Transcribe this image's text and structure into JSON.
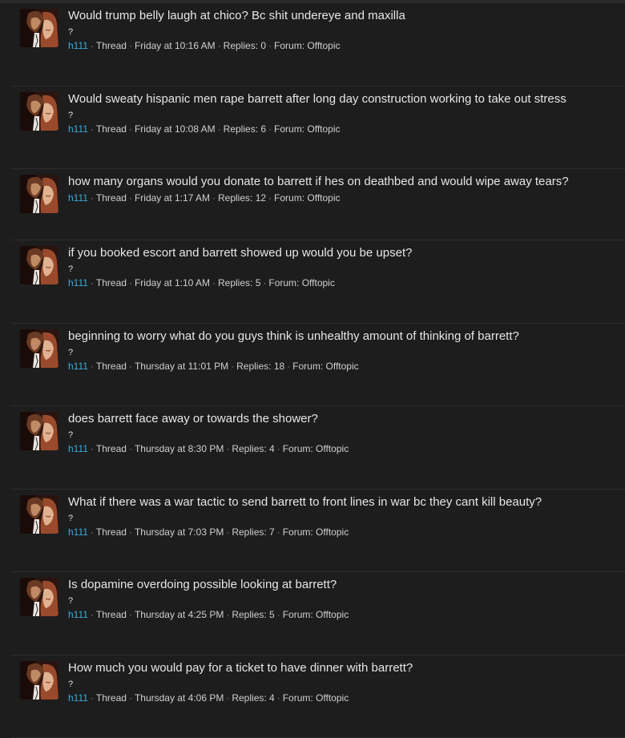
{
  "threads": [
    {
      "title": "Would trump belly laugh at chico? Bc shit undereye and maxilla",
      "snippet": "?",
      "user": "h111",
      "type": "Thread",
      "time": "Friday at 10:16 AM",
      "replies": "Replies: 0",
      "forum": "Forum: Offtopic"
    },
    {
      "title": "Would sweaty hispanic men rape barrett after long day construction working to take out stress",
      "snippet": "?",
      "user": "h111",
      "type": "Thread",
      "time": "Friday at 10:08 AM",
      "replies": "Replies: 6",
      "forum": "Forum: Offtopic"
    },
    {
      "title": "how many organs would you donate to barrett if hes on deathbed and would wipe away tears?",
      "snippet": "",
      "user": "h111",
      "type": "Thread",
      "time": "Friday at 1:17 AM",
      "replies": "Replies: 12",
      "forum": "Forum: Offtopic"
    },
    {
      "title": "if you booked escort and barrett showed up would you be upset?",
      "snippet": "?",
      "user": "h111",
      "type": "Thread",
      "time": "Friday at 1:10 AM",
      "replies": "Replies: 5",
      "forum": "Forum: Offtopic"
    },
    {
      "title": "beginning to worry what do you guys think is unhealthy amount of thinking of barrett?",
      "snippet": "?",
      "user": "h111",
      "type": "Thread",
      "time": "Thursday at 11:01 PM",
      "replies": "Replies: 18",
      "forum": "Forum: Offtopic"
    },
    {
      "title": "does barrett face away or towards the shower?",
      "snippet": "?",
      "user": "h111",
      "type": "Thread",
      "time": "Thursday at 8:30 PM",
      "replies": "Replies: 4",
      "forum": "Forum: Offtopic"
    },
    {
      "title": "What if there was a war tactic to send barrett to front lines in war bc they cant kill beauty?",
      "snippet": "?",
      "user": "h111",
      "type": "Thread",
      "time": "Thursday at 7:03 PM",
      "replies": "Replies: 7",
      "forum": "Forum: Offtopic"
    },
    {
      "title": "Is dopamine overdoing possible looking at barrett?",
      "snippet": "?",
      "user": "h111",
      "type": "Thread",
      "time": "Thursday at 4:25 PM",
      "replies": "Replies: 5",
      "forum": "Forum: Offtopic"
    },
    {
      "title": "How much you would pay for a ticket to have dinner with barrett?",
      "snippet": "?",
      "user": "h111",
      "type": "Thread",
      "time": "Thursday at 4:06 PM",
      "replies": "Replies: 4",
      "forum": "Forum: Offtopic"
    }
  ],
  "separator": "·"
}
